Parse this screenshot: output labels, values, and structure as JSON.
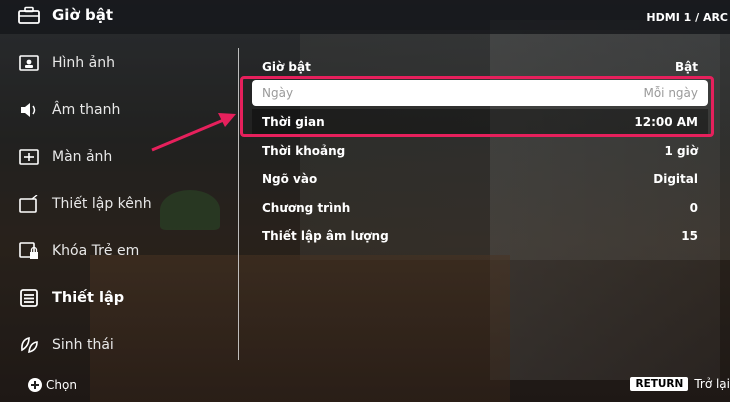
{
  "header": {
    "title": "Giờ bật",
    "input_source": "HDMI 1 / ARC"
  },
  "sidebar": {
    "items": [
      {
        "label": "Hình ảnh",
        "icon": "picture-icon"
      },
      {
        "label": "Âm thanh",
        "icon": "speaker-icon"
      },
      {
        "label": "Màn ảnh",
        "icon": "screen-icon"
      },
      {
        "label": "Thiết lập kênh",
        "icon": "channel-setup-icon"
      },
      {
        "label": "Khóa Trẻ em",
        "icon": "parental-lock-icon"
      },
      {
        "label": "Thiết lập",
        "icon": "settings-list-icon",
        "active": true
      },
      {
        "label": "Sinh thái",
        "icon": "eco-leaf-icon"
      }
    ]
  },
  "settings": {
    "rows": [
      {
        "label": "Giờ bật",
        "value": "Bật"
      },
      {
        "label": "Ngày",
        "value": "Mỗi ngày"
      },
      {
        "label": "Thời gian",
        "value": "12:00 AM"
      },
      {
        "label": "Thời khoảng",
        "value": "1 giờ"
      },
      {
        "label": "Ngõ vào",
        "value": "Digital"
      },
      {
        "label": "Chương trình",
        "value": "0"
      },
      {
        "label": "Thiết lập âm lượng",
        "value": "15"
      }
    ]
  },
  "footer": {
    "select_label": "Chọn",
    "return_key": "RETURN",
    "return_label": "Trở lại"
  },
  "colors": {
    "callout": "#e6205c",
    "selected_row_bg": "#ffffff"
  }
}
